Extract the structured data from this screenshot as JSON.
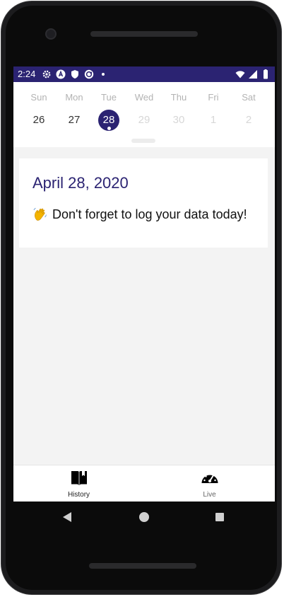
{
  "status_bar": {
    "time": "2:24",
    "icons_left": [
      "settings-icon",
      "app-icon",
      "shield-icon",
      "sync-icon",
      "dot-icon"
    ],
    "icons_right": [
      "wifi-icon",
      "signal-icon",
      "battery-icon"
    ],
    "bg_color": "#2b2372"
  },
  "calendar": {
    "days": [
      {
        "name": "Sun",
        "date": "26",
        "state": "normal"
      },
      {
        "name": "Mon",
        "date": "27",
        "state": "normal"
      },
      {
        "name": "Tue",
        "date": "28",
        "state": "selected"
      },
      {
        "name": "Wed",
        "date": "29",
        "state": "disabled"
      },
      {
        "name": "Thu",
        "date": "30",
        "state": "disabled"
      },
      {
        "name": "Fri",
        "date": "1",
        "state": "disabled"
      },
      {
        "name": "Sat",
        "date": "2",
        "state": "disabled"
      }
    ],
    "accent_color": "#2b2372"
  },
  "card": {
    "date": "April 28, 2020",
    "emoji_icon": "waving-hand-icon",
    "message": "Don't forget to log your data today!"
  },
  "bottom_nav": {
    "items": [
      {
        "label": "History",
        "icon": "book-icon",
        "active": true
      },
      {
        "label": "Live",
        "icon": "speedometer-icon",
        "active": false
      }
    ]
  },
  "system_nav": [
    "back-icon",
    "home-icon",
    "recents-icon"
  ]
}
